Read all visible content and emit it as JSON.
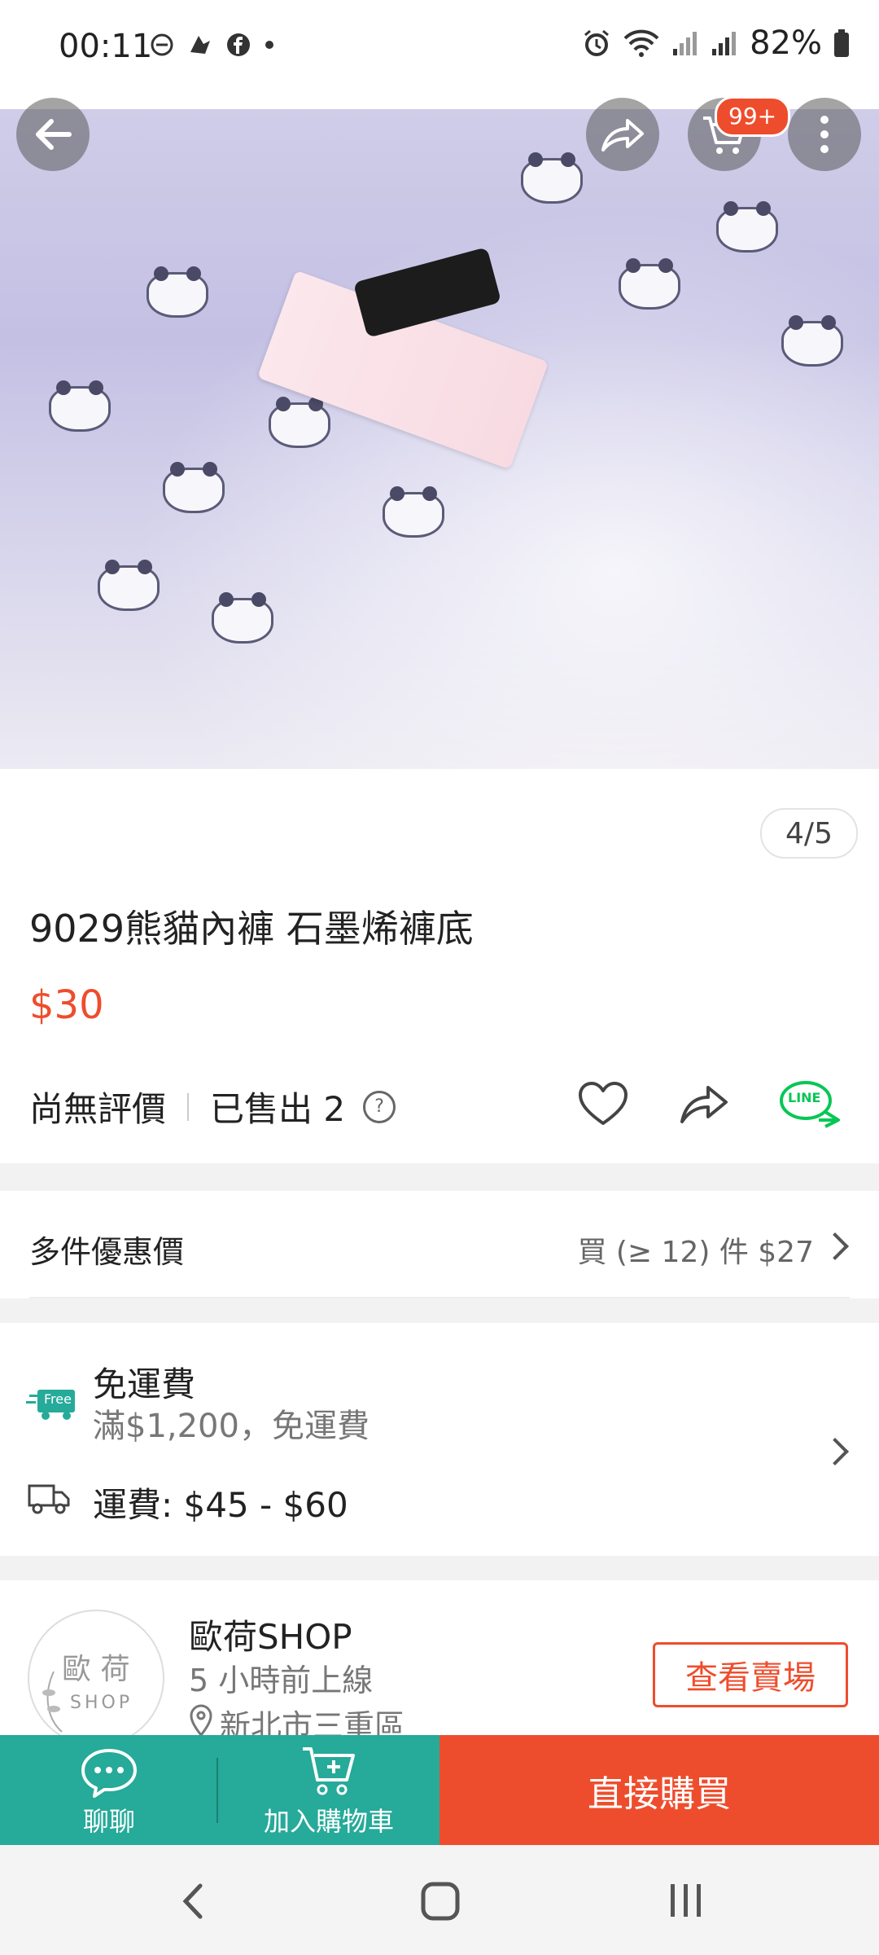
{
  "status_bar": {
    "time": "00:11",
    "battery": "82%",
    "icons_left": [
      "do-not-disturb-icon",
      "notification-icon",
      "facebook-icon",
      "dot-icon"
    ],
    "icons_right": [
      "alarm-icon",
      "wifi-icon",
      "signal-icon",
      "signal-icon",
      "battery-icon"
    ]
  },
  "header": {
    "cart_badge": "99+",
    "image_counter": "4/5"
  },
  "product": {
    "title": "9029熊貓內褲 石墨烯褲底",
    "price": "$30",
    "rating_text": "尚無評價",
    "sold_text": "已售出 2",
    "help_mark": "?"
  },
  "discount": {
    "label": "多件優惠價",
    "detail": "買 (≥ 12) 件 $27"
  },
  "shipping": {
    "free_badge": "Free",
    "free_title": "免運費",
    "free_detail": "滿$1,200，免運費",
    "fee_text": "運費: $45 - $60"
  },
  "shop": {
    "logo_text_top": "歐 荷",
    "logo_text_bottom": "SHOP",
    "name": "歐荷SHOP",
    "online": "5 小時前上線",
    "location": "新北市三重區",
    "view_button": "查看賣場"
  },
  "bottom_bar": {
    "chat_label": "聊聊",
    "cart_label": "加入購物車",
    "buy_label": "直接購買"
  },
  "line_label": "LINE",
  "colors": {
    "accent": "#ee4d2d",
    "teal": "#26aa99",
    "line_green": "#06c755"
  }
}
